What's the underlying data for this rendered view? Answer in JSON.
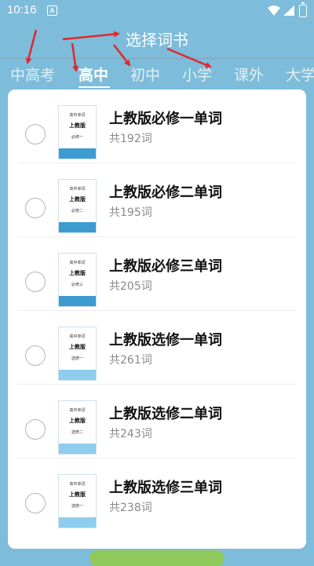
{
  "status_bar": {
    "time": "10:16",
    "notification_icon_text": "A"
  },
  "header": {
    "title": "选择词书"
  },
  "tabs": [
    {
      "label": "中高考",
      "active": false
    },
    {
      "label": "高中",
      "active": true
    },
    {
      "label": "初中",
      "active": false
    },
    {
      "label": "小学",
      "active": false
    },
    {
      "label": "课外",
      "active": false
    },
    {
      "label": "大学",
      "active": false
    }
  ],
  "annotation_color": "#e0282d",
  "books": [
    {
      "title": "上教版必修一单词",
      "count": "共192词",
      "cover_series": "高中单词",
      "cover_edition": "上教版",
      "cover_volume": "必修一",
      "band_color": "#3d9bd2",
      "selected": false
    },
    {
      "title": "上教版必修二单词",
      "count": "共195词",
      "cover_series": "高中单词",
      "cover_edition": "上教版",
      "cover_volume": "必修二",
      "band_color": "#3d9bd2",
      "selected": false
    },
    {
      "title": "上教版必修三单词",
      "count": "共205词",
      "cover_series": "高中单词",
      "cover_edition": "上教版",
      "cover_volume": "必修三",
      "band_color": "#3d9bd2",
      "selected": false
    },
    {
      "title": "上教版选修一单词",
      "count": "共261词",
      "cover_series": "高中单词",
      "cover_edition": "上教版",
      "cover_volume": "选修一",
      "band_color": "#8ecdee",
      "selected": false
    },
    {
      "title": "上教版选修二单词",
      "count": "共243词",
      "cover_series": "高中单词",
      "cover_edition": "上教版",
      "cover_volume": "选修二",
      "band_color": "#8ecdee",
      "selected": false
    },
    {
      "title": "上教版选修三单词",
      "count": "共238词",
      "cover_series": "高中单词",
      "cover_edition": "上教版",
      "cover_volume": "选修一",
      "band_color": "#8ecdee",
      "selected": false
    }
  ]
}
